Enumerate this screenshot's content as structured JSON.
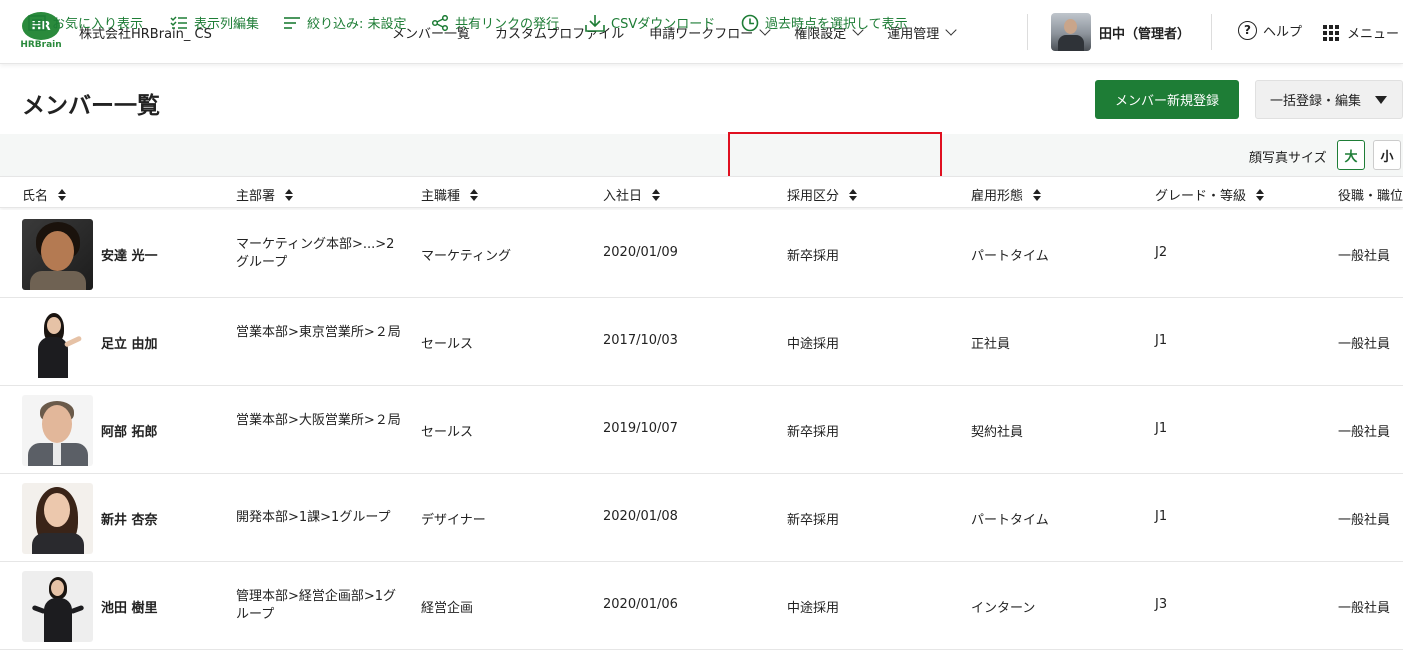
{
  "header": {
    "logo_text": "HR",
    "logo_sub": "HRBrain",
    "company": "株式会社HRBrain_ CS",
    "nav": [
      {
        "label": "メンバー一覧",
        "dropdown": false
      },
      {
        "label": "カスタムプロファイル",
        "dropdown": false
      },
      {
        "label": "申請ワークフロー",
        "dropdown": true
      },
      {
        "label": "権限設定",
        "dropdown": true
      },
      {
        "label": "運用管理",
        "dropdown": true
      }
    ],
    "user_name": "田中（管理者）",
    "help_label": "ヘルプ",
    "menu_label": "メニュー"
  },
  "page": {
    "title": "メンバー一覧",
    "primary_button": "メンバー新規登録",
    "secondary_button": "一括登録・編集"
  },
  "toolbar": {
    "favorites": "お気に入り表示",
    "columns": "表示列編集",
    "filter": "絞り込み: 未設定",
    "share": "共有リンクの発行",
    "csv": "CSVダウンロード",
    "past": "過去時点を選択して表示",
    "photo_size_label": "顔写真サイズ",
    "size_large": "大",
    "size_small": "小"
  },
  "colors": {
    "brand_green": "#1e7d36",
    "highlight_red": "#e01020"
  },
  "table": {
    "headers": [
      "氏名",
      "主部署",
      "主職種",
      "入社日",
      "採用区分",
      "雇用形態",
      "グレード・等級",
      "役職・職位"
    ],
    "rows": [
      {
        "name": "安達 光一",
        "dept": "マーケティング本部>...>2グループ",
        "job": "マーケティング",
        "joined": "2020/01/09",
        "hire_type": "新卒採用",
        "employment": "パートタイム",
        "grade": "J2",
        "position": "一般社員"
      },
      {
        "name": "足立 由加",
        "dept": "営業本部>東京営業所>２局",
        "job": "セールス",
        "joined": "2017/10/03",
        "hire_type": "中途採用",
        "employment": "正社員",
        "grade": "J1",
        "position": "一般社員"
      },
      {
        "name": "阿部 拓郎",
        "dept": "営業本部>大阪営業所>２局",
        "job": "セールス",
        "joined": "2019/10/07",
        "hire_type": "新卒採用",
        "employment": "契約社員",
        "grade": "J1",
        "position": "一般社員"
      },
      {
        "name": "新井 杏奈",
        "dept": "開発本部>1課>1グループ",
        "job": "デザイナー",
        "joined": "2020/01/08",
        "hire_type": "新卒採用",
        "employment": "パートタイム",
        "grade": "J1",
        "position": "一般社員"
      },
      {
        "name": "池田 樹里",
        "dept": "管理本部>経営企画部>1グループ",
        "job": "経営企画",
        "joined": "2020/01/06",
        "hire_type": "中途採用",
        "employment": "インターン",
        "grade": "J3",
        "position": "一般社員"
      }
    ]
  }
}
